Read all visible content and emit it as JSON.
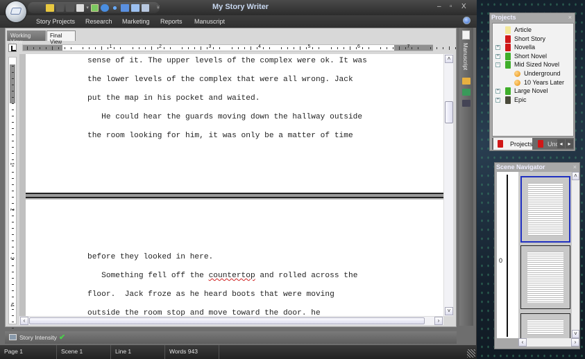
{
  "app": {
    "title": "My Story Writer"
  },
  "window_controls": {
    "minimize": "–",
    "maximize": "▫",
    "close": "X"
  },
  "quick_access": [
    "folder-icon",
    "save-icon",
    "save-all-icon",
    "print-icon",
    "dropdown-icon",
    "grid-icon",
    "bubble-icon",
    "dots-icon",
    "layout-icon",
    "view-icon",
    "panel-icon"
  ],
  "menu": [
    "Story Projects",
    "Research",
    "Marketing",
    "Reports",
    "Manuscript"
  ],
  "view_tabs": [
    {
      "label": "Working View",
      "active": false
    },
    {
      "label": "Final View",
      "active": true
    }
  ],
  "ruler": {
    "h_numbers": [
      "1",
      "2",
      "3",
      "4",
      "5",
      "6",
      "7"
    ],
    "v_numbers": [
      "1",
      "2",
      "3",
      "4"
    ]
  },
  "document": {
    "page1_lines": [
      "sense of it. The upper levels of the complex were ok. It was",
      "the lower levels of the complex that were all wrong. Jack",
      "put the map in his pocket and waited.",
      "   He could hear the guards moving down the hallway outside",
      "the room looking for him, it was only be a matter of time"
    ],
    "page2_lines": [
      "before they looked in here.",
      "   Something fell off the ",
      "floor.  Jack froze as he heard boots that were moving",
      "outside the room stop and move toward the door. he"
    ],
    "misspelled_word": "countertop",
    "after_misspelled": " and rolled across the"
  },
  "side_strip": {
    "label": "Manuscript"
  },
  "intensity": {
    "label": "Story Intensity"
  },
  "status": {
    "page": "Page 1",
    "scene": "Scene 1",
    "line": "Line 1",
    "words": "Words 943"
  },
  "projects": {
    "title": "Projects",
    "items": [
      {
        "label": "Article",
        "expander": "",
        "color": "#f3e79a",
        "level": 0
      },
      {
        "label": "Short Story",
        "expander": "",
        "color": "#d01818",
        "level": 0
      },
      {
        "label": "Novella",
        "expander": "+",
        "color": "#d01818",
        "level": 0
      },
      {
        "label": "Short Novel",
        "expander": "+",
        "color": "#3fae2a",
        "level": 0
      },
      {
        "label": "Mid Sized Novel",
        "expander": "−",
        "color": "#3fae2a",
        "level": 0
      },
      {
        "label": "Underground",
        "expander": "",
        "color": "#e8920e",
        "level": 1
      },
      {
        "label": "10 Years Later",
        "expander": "",
        "color": "#e8920e",
        "level": 1
      },
      {
        "label": "Large Novel",
        "expander": "+",
        "color": "#3fae2a",
        "level": 0
      },
      {
        "label": "Epic",
        "expander": "+",
        "color": "#4a4a3a",
        "level": 0
      }
    ],
    "tabs": [
      {
        "label": "Projects"
      },
      {
        "label": "Unc"
      }
    ]
  },
  "scene_navigator": {
    "title": "Scene Navigator",
    "marker": "0"
  }
}
